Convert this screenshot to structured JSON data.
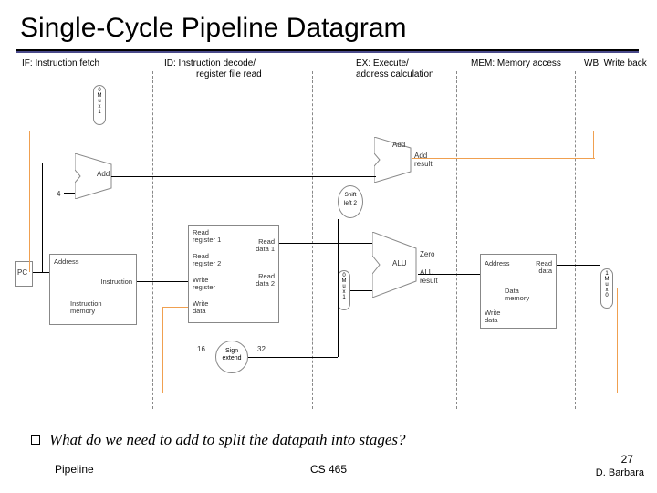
{
  "title": "Single-Cycle Pipeline Datagram",
  "stages": {
    "if": {
      "label": "IF: Instruction fetch"
    },
    "id": {
      "label": "ID: Instruction decode/",
      "label2": "register file read"
    },
    "ex": {
      "label": "EX: Execute/",
      "label2": "address calculation"
    },
    "mem": {
      "label": "MEM: Memory access"
    },
    "wb": {
      "label": "WB: Write back"
    }
  },
  "blocks": {
    "pc": "PC",
    "imem": {
      "addr": "Address",
      "name": "Instruction\nmemory",
      "out": "Instruction"
    },
    "add1": "Add",
    "const4": "4",
    "regfile": {
      "rr1": "Read\nregister 1",
      "rr2": "Read\nregister 2",
      "wr": "Write\nregister",
      "wd": "Write\ndata",
      "rd1": "Read\ndata 1",
      "rd2": "Read\ndata 2"
    },
    "signext": "Sign\nextend",
    "shift": "Shift\nleft 2",
    "add2": "Add",
    "add2out": "Add\nresult",
    "alu": "ALU",
    "aluout": "ALU\nresult",
    "aluzero": "Zero",
    "dmem": {
      "addr": "Address",
      "name": "Data\nmemory",
      "wd": "Write\ndata",
      "rd": "Read\ndata"
    },
    "mux0": "0\nM\nu\nx\n1",
    "mux1": "0\nM\nu\nx\n1",
    "mux2": "1\nM\nu\nx\n0",
    "bits16": "16",
    "bits32": "32"
  },
  "bullet": "What do we need to add to split the datapath into stages?",
  "footer": {
    "left": "Pipeline",
    "center": "CS 465",
    "page": "27",
    "author": "D. Barbara"
  }
}
